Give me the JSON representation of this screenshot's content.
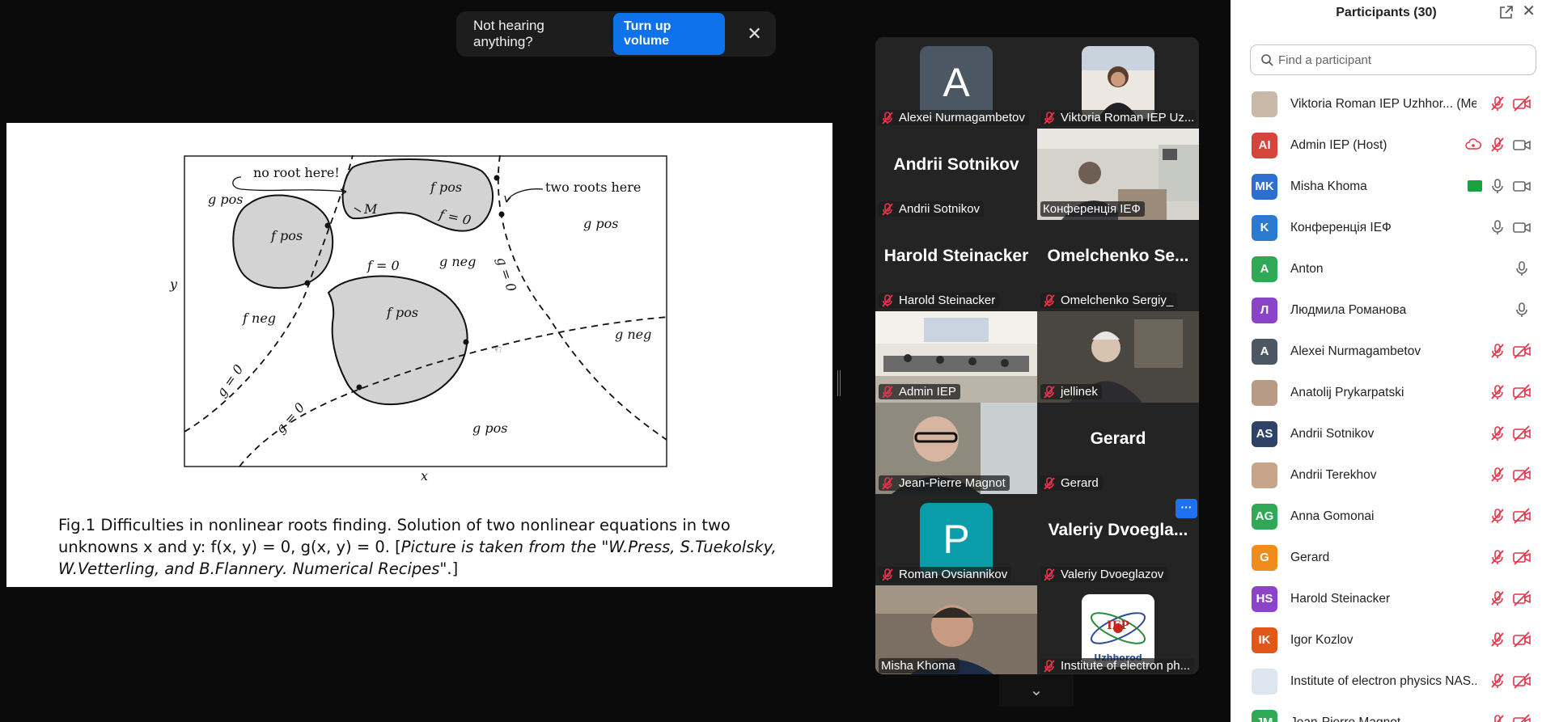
{
  "notification": {
    "text": "Not hearing anything?",
    "button": "Turn up volume",
    "close": "✕"
  },
  "slide": {
    "figure_labels": {
      "no_root": "no root here!",
      "two_roots": "two roots here",
      "M": "M",
      "g_pos_tl": "g pos",
      "f_pos_1": "f pos",
      "f_pos_2": "f pos",
      "f_pos_3": "f pos",
      "f_eq_0_a": "f = 0",
      "f_eq_0_b": "f = 0",
      "g_neg_1": "g neg",
      "g_eq_0_a": "g = 0",
      "g_pos_r": "g pos",
      "g_neg_2": "g neg",
      "f_neg": "f neg",
      "g_eq_0_b": "g = 0",
      "g_eq_0_c": "g = 0",
      "g_pos_b": "g pos",
      "y_axis": "y",
      "x_axis": "x"
    },
    "caption_plain": "Fig.1 Difficulties in nonlinear roots finding. Solution of two nonlinear equations in two unknowns x and y: f(x, y) = 0, g(x, y) = 0. [",
    "caption_italic": "Picture is taken from the \"W.Press, S.Tuekolsky, W.Vetterling, and B.Flannery. Numerical Recipes\"",
    "caption_end": ".]"
  },
  "grid": {
    "tiles": [
      {
        "name": "Alexei Nurmagambetov",
        "initial": "A"
      },
      {
        "name": "Viktoria Roman IEP Uz..."
      },
      {
        "name": "Andrii Sotnikov",
        "big": "Andrii Sotnikov"
      },
      {
        "name": "Конференція ІЕФ"
      },
      {
        "name": "Harold Steinacker",
        "big": "Harold Steinacker"
      },
      {
        "name": "Omelchenko Sergiy_",
        "big": "Omelchenko  Se..."
      },
      {
        "name": "Admin IEP"
      },
      {
        "name": "jellinek"
      },
      {
        "name": "Jean-Pierre Magnot"
      },
      {
        "name": "Gerard",
        "big": "Gerard"
      },
      {
        "name": "Roman Ovsiannikov",
        "initial": "P"
      },
      {
        "name": "Valeriy Dvoeglazov",
        "big": "Valeriy  Dvoegla..."
      },
      {
        "name": "Misha Khoma"
      },
      {
        "name": "Institute of electron ph..."
      }
    ],
    "more": "···",
    "scroll": "⌄"
  },
  "panel": {
    "title": "Participants (30)",
    "close": "✕",
    "search_placeholder": "Find a participant",
    "participants": [
      {
        "initials": "",
        "name": "Viktoria Roman IEP Uzhhor...  (Me)",
        "color": "#c9b9a8"
      },
      {
        "initials": "AI",
        "name": "Admin IEP (Host)",
        "color": "#d6453b"
      },
      {
        "initials": "MK",
        "name": "Misha Khoma",
        "color": "#2d6fd0"
      },
      {
        "initials": "K",
        "name": "Конференція ІЕФ",
        "color": "#2a7ad1"
      },
      {
        "initials": "A",
        "name": "Anton",
        "color": "#2fa955"
      },
      {
        "initials": "Л",
        "name": "Людмила Романова",
        "color": "#8b43c9"
      },
      {
        "initials": "A",
        "name": "Alexei Nurmagambetov",
        "color": "#4b5863"
      },
      {
        "initials": "",
        "name": "Anatolij Prykarpatski",
        "color": "#b89a86"
      },
      {
        "initials": "AS",
        "name": "Andrii Sotnikov",
        "color": "#2e4466"
      },
      {
        "initials": "",
        "name": "Andrii Terekhov",
        "color": "#c8a48a"
      },
      {
        "initials": "AG",
        "name": "Anna Gomonai",
        "color": "#2fa955"
      },
      {
        "initials": "G",
        "name": "Gerard",
        "color": "#f08c1c"
      },
      {
        "initials": "HS",
        "name": "Harold Steinacker",
        "color": "#8b43c9"
      },
      {
        "initials": "IK",
        "name": "Igor Kozlov",
        "color": "#e2561a"
      },
      {
        "initials": "",
        "name": "Institute of electron physics NAS...",
        "color": "#dde6ee"
      },
      {
        "initials": "JM",
        "name": "Jean-Pierre Magnot",
        "color": "#2fa955"
      }
    ]
  },
  "colors": {
    "accent": "#0e72ed",
    "active_speaker": "#2ee68a",
    "muted": "#e2364b"
  }
}
